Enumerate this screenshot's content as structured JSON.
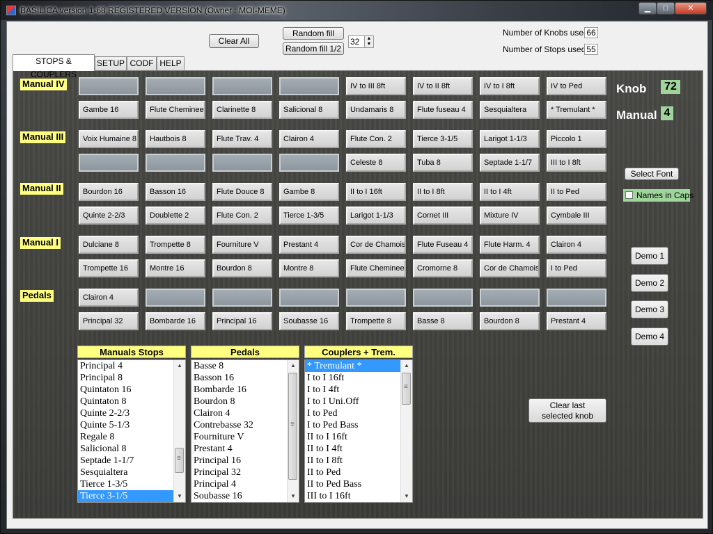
{
  "window": {
    "title": "BASILICA version 1-68  REGISTERED VERSION (Owner : MOI-MEME)"
  },
  "toolbar": {
    "clear_all": "Clear All",
    "random_fill": "Random fill",
    "random_fill_half": "Random fill 1/2",
    "spin_value": "32",
    "knobs_label": "Number of Knobs used",
    "knobs_value": "66",
    "stops_label": "Number of Stops  used",
    "stops_value": "55"
  },
  "tabs": [
    "STOPS & COUPLERS",
    "SETUP",
    "CODF",
    "HELP"
  ],
  "manuals": {
    "iv": "Manual IV",
    "iii": "Manual III",
    "ii": "Manual II",
    "i": "Manual I",
    "pedals": "Pedals"
  },
  "stops": {
    "iv_row1": [
      "",
      "",
      "",
      "",
      "IV to III 8ft",
      "IV to II 8ft",
      "IV to I 8ft",
      "IV to Ped"
    ],
    "iv_row2": [
      "Gambe 16",
      "Flute Cheminee",
      "Clarinette 8",
      "Salicional 8",
      "Undamaris 8",
      "Flute fuseau 4",
      "Sesquialtera",
      "* Tremulant *"
    ],
    "iii_row1": [
      "Voix Humaine 8",
      "Hautbois 8",
      "Flute Trav. 4",
      "Clairon 4",
      "Flute Con. 2",
      "Tierce 3-1/5",
      "Larigot 1-1/3",
      "Piccolo 1"
    ],
    "iii_row2": [
      "",
      "",
      "",
      "",
      "Celeste 8",
      "Tuba 8",
      "Septade 1-1/7",
      "III to I 8ft"
    ],
    "ii_row1": [
      "Bourdon 16",
      "Basson 16",
      "Flute Douce 8",
      "Gambe 8",
      "II to I 16ft",
      "II to I 8ft",
      "II to I 4ft",
      "II to Ped"
    ],
    "ii_row2": [
      "Quinte 2-2/3",
      "Doublette 2",
      "Flute Con. 2",
      "Tierce 1-3/5",
      "Larigot 1-1/3",
      "Cornet III",
      "Mixture IV",
      "Cymbale III"
    ],
    "i_row1": [
      "Dulciane 8",
      "Trompette 8",
      "Fourniture V",
      "Prestant 4",
      "Cor de Chamois",
      "Flute Fuseau 4",
      "Flute Harm. 4",
      "Clairon 4"
    ],
    "i_row2": [
      "Trompette 16",
      "Montre 16",
      "Bourdon 8",
      "Montre 8",
      "Flute Cheminee",
      "Cromorne 8",
      "Cor de Chamois",
      "I to Ped"
    ],
    "ped_row1": [
      "Clairon 4",
      "",
      "",
      "",
      "",
      "",
      "",
      ""
    ],
    "ped_row2": [
      "Principal 32",
      "Bombarde 16",
      "Principal 16",
      "Soubasse 16",
      "Trompette 8",
      "Basse 8",
      "Bourdon 8",
      "Prestant 4"
    ]
  },
  "status": {
    "knob_label": "Knob",
    "knob_value": "72",
    "manual_label": "Manual",
    "manual_value": "4"
  },
  "options": {
    "select_font": "Select Font",
    "names_in_caps": "Names in Caps"
  },
  "demos": [
    "Demo 1",
    "Demo 2",
    "Demo 3",
    "Demo 4"
  ],
  "clear_last": "Clear last selected knob",
  "lists": {
    "manuals_header": "Manuals Stops",
    "manuals_items": [
      "Principal 4",
      "Principal 8",
      "Quintaton 16",
      "Quintaton 8",
      "Quinte 2-2/3",
      "Quinte 5-1/3",
      "Regale 8",
      "Salicional 8",
      "Septade 1-1/7",
      "Sesquialtera",
      "Tierce 1-3/5",
      "Tierce 3-1/5"
    ],
    "manuals_selected": 11,
    "pedals_header": "Pedals",
    "pedals_items": [
      "Basse 8",
      "Basson 16",
      "Bombarde 16",
      "Bourdon 8",
      "Clairon 4",
      "Contrebasse 32",
      "Fourniture V",
      "Prestant 4",
      "Principal 16",
      "Principal 32",
      "Principal 4",
      "Soubasse 16"
    ],
    "couplers_header": "Couplers + Trem.",
    "couplers_items": [
      "* Tremulant *",
      "I to I 16ft",
      "I to I 4ft",
      "I to I Uni.Off",
      "I to Ped",
      "I to Ped Bass",
      "II to I 16ft",
      "II to I 4ft",
      "II to I 8ft",
      "II to Ped",
      "II to Ped Bass",
      "III to I 16ft"
    ],
    "couplers_selected": 0
  }
}
